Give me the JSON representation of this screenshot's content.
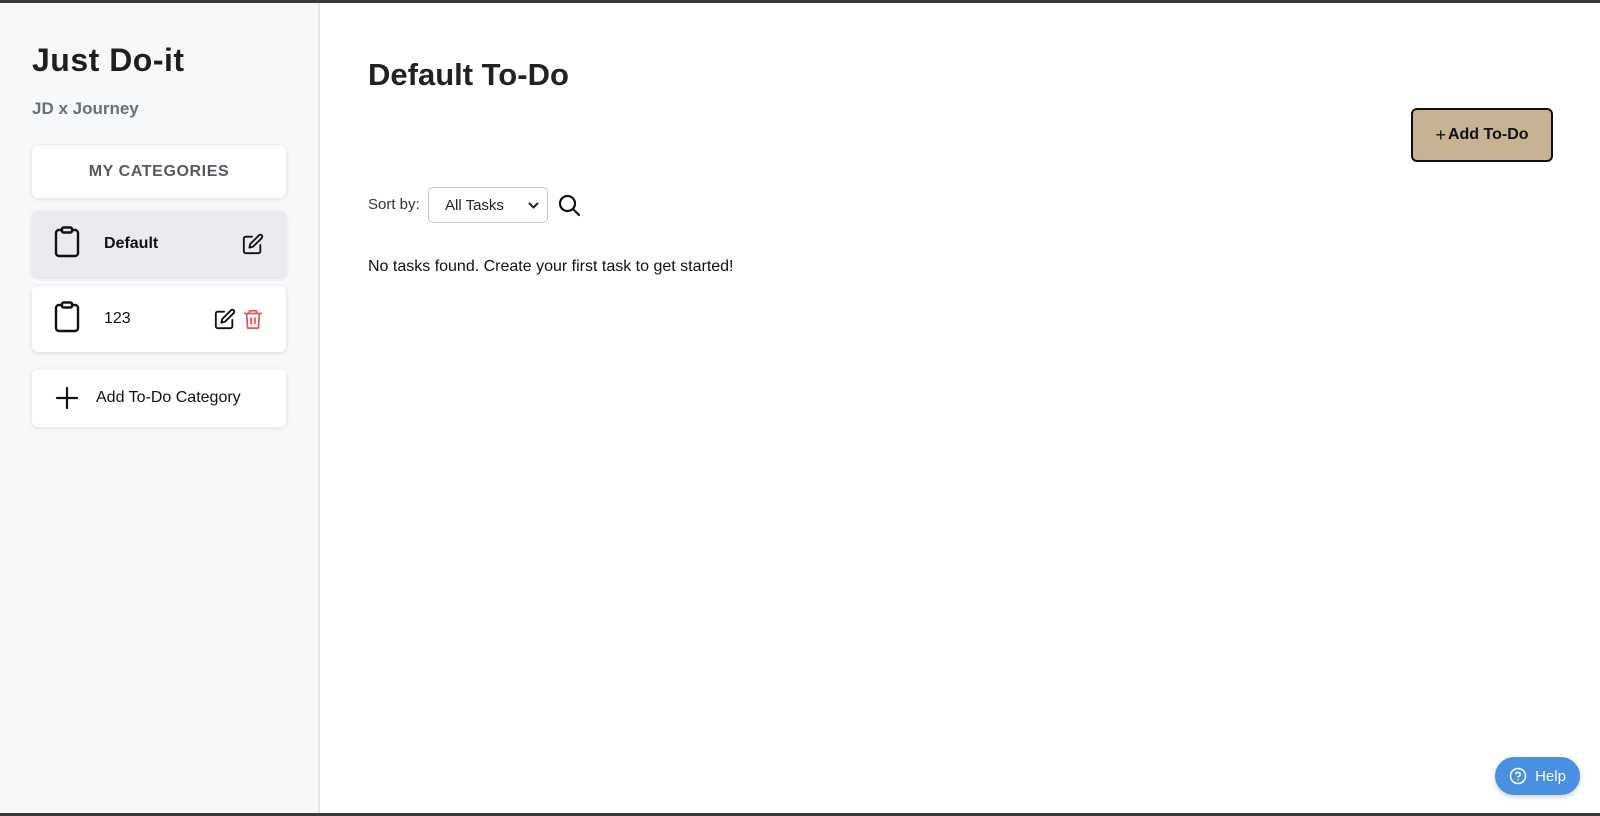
{
  "sidebar": {
    "app_title": "Just Do-it",
    "app_subtitle": "JD x Journey",
    "categories_header": "MY CATEGORIES",
    "categories": [
      {
        "label": "Default",
        "active": true,
        "deletable": false
      },
      {
        "label": "123",
        "active": false,
        "deletable": true
      }
    ],
    "add_category_label": "Add To-Do Category"
  },
  "main": {
    "title": "Default To-Do",
    "add_todo_plus": "+",
    "add_todo_label": "Add To-Do",
    "sort_label": "Sort by:",
    "sort_selected": "All Tasks",
    "empty_message": "No tasks found. Create your first task to get started!"
  },
  "help": {
    "label": "Help"
  },
  "colors": {
    "accent_button": "#c7b293",
    "help_button": "#4a90e2",
    "delete_icon": "#e05a5a",
    "sidebar_bg": "#f7f8fa"
  },
  "icons": [
    "clipboard-icon",
    "edit-icon",
    "trash-icon",
    "plus-icon",
    "search-icon",
    "chevron-down-icon",
    "help-circle-icon"
  ]
}
